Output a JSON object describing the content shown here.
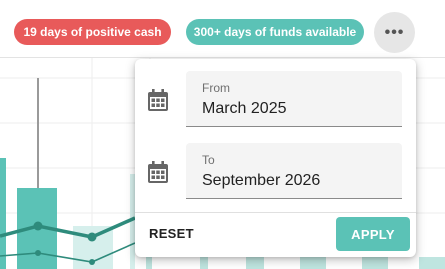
{
  "header": {
    "positive_cash_badge": "19 days of positive cash",
    "funds_available_badge": "300+ days of funds available",
    "more_button_glyph": "•••"
  },
  "colors": {
    "negative_red": "#e85a5a",
    "accent_teal": "#5bc2b6",
    "dark_teal_line": "#2e8b7c"
  },
  "date_range": {
    "from_label": "From",
    "from_value": "March 2025",
    "to_label": "To",
    "to_value": "September 2026",
    "reset_label": "RESET",
    "apply_label": "APPLY",
    "icons": [
      "calendar-icon",
      "calendar-icon"
    ]
  }
}
